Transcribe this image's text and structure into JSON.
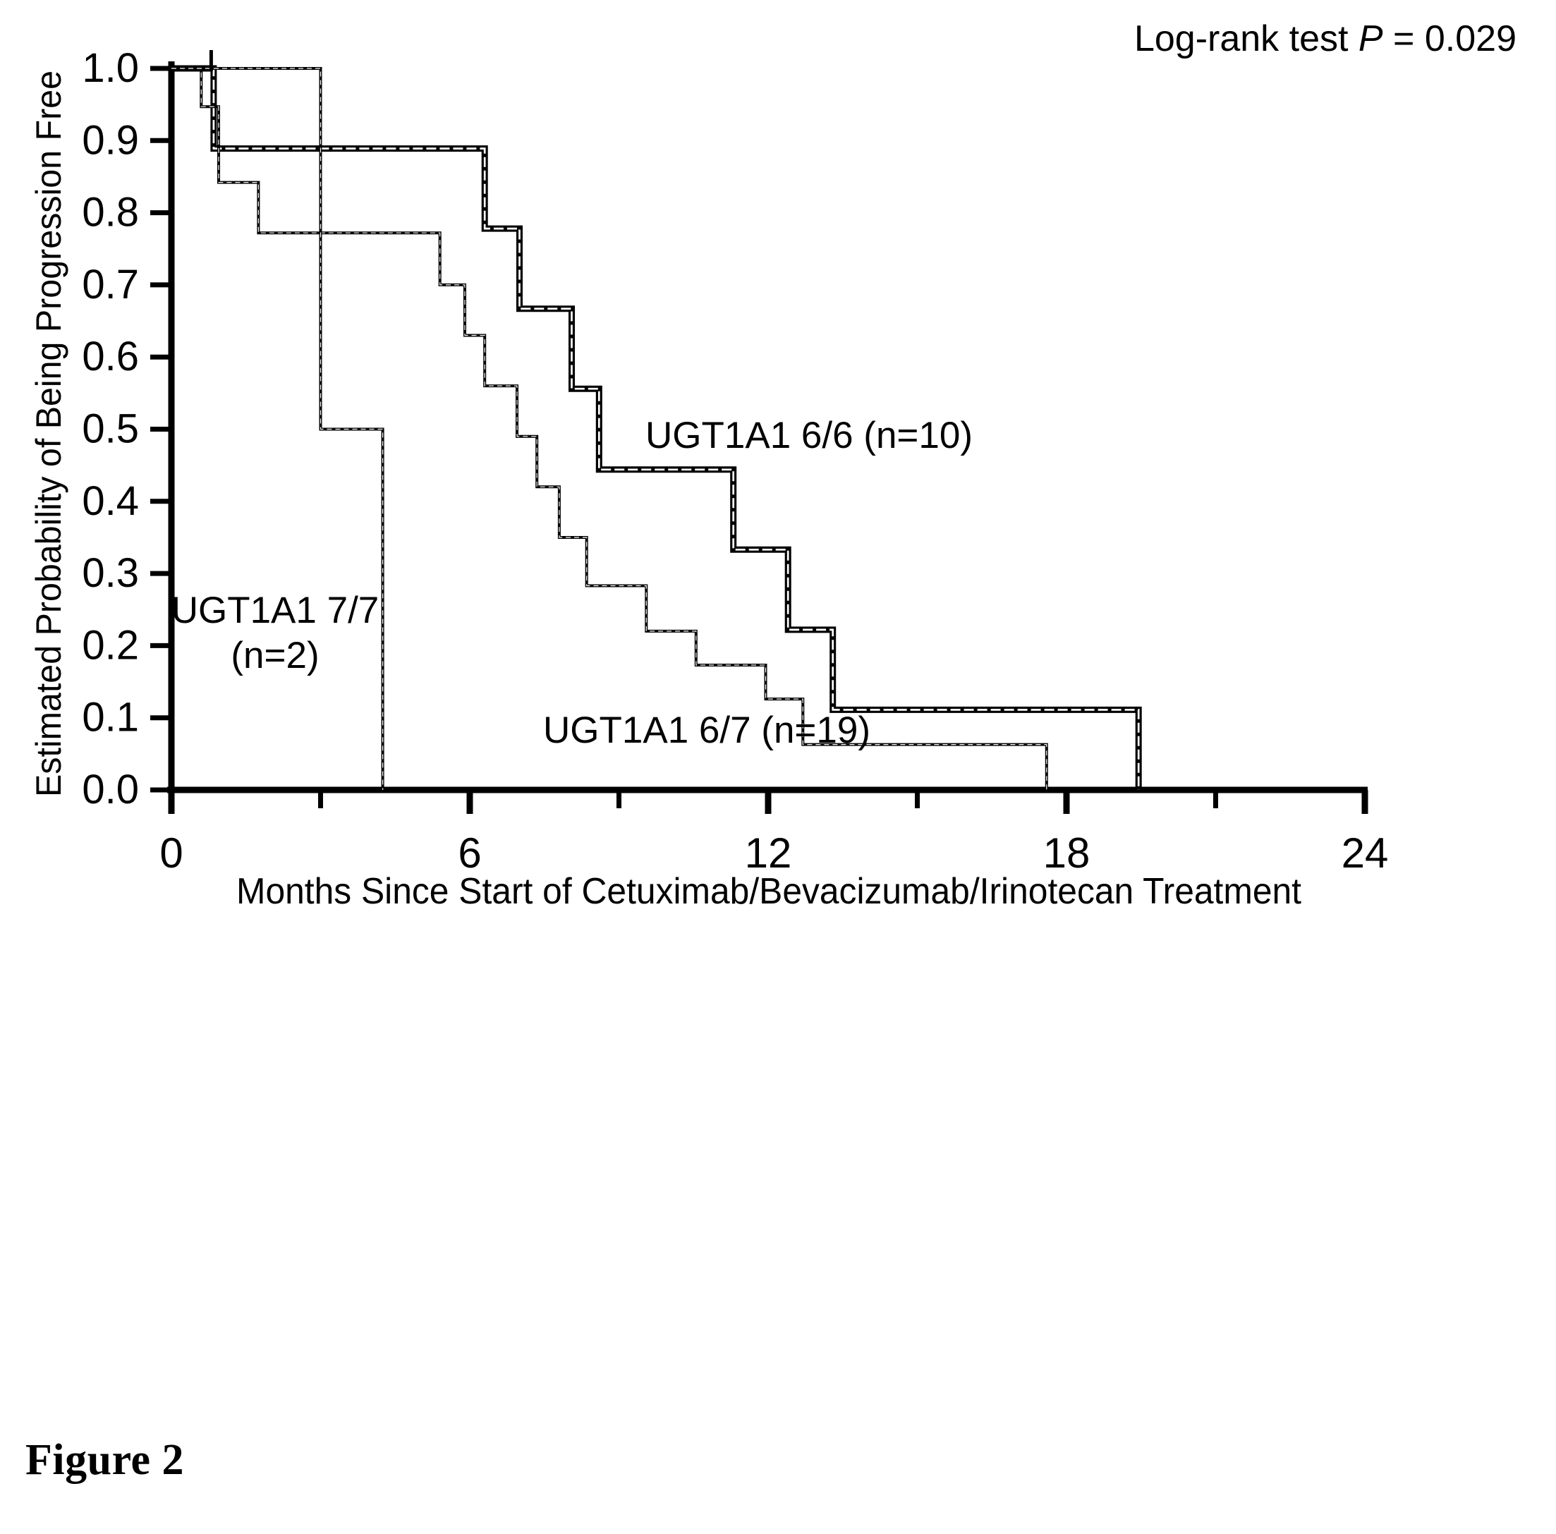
{
  "figure": {
    "caption": "Figure 2",
    "statistic_label": "Log-rank test",
    "statistic_italic": "P",
    "statistic_value": "= 0.029",
    "statistic_full": "Log-rank test P = 0.029"
  },
  "annotations": {
    "curve_66": "UGT1A1 6/6 (n=10)",
    "curve_77_line1": "UGT1A1 7/7",
    "curve_77_line2": "(n=2)",
    "curve_67": "UGT1A1 6/7 (n=19)"
  },
  "colors": {
    "axis": "#000000",
    "curve_66": "#000000",
    "curve_67": "#000000",
    "curve_77": "#000000",
    "background": "#ffffff"
  },
  "chart_data": {
    "type": "line",
    "subtype": "kaplan-meier-step",
    "title": "",
    "xlabel": "Months  Since  Start of Cetuximab/Bevacizumab/Irinotecan Treatment",
    "ylabel": "Estimated Probability  of  Being Progression Free",
    "xlim": [
      0,
      24
    ],
    "ylim": [
      0,
      1
    ],
    "xticks": [
      0,
      6,
      12,
      18,
      24
    ],
    "xtick_labels": [
      "0",
      "6",
      "12",
      "18",
      "24"
    ],
    "xminor_ticks": [
      3,
      9,
      15,
      21
    ],
    "yticks": [
      0.0,
      0.1,
      0.2,
      0.3,
      0.4,
      0.5,
      0.6,
      0.7,
      0.8,
      0.9,
      1.0
    ],
    "ytick_labels": [
      "0.0",
      "0.1",
      "0.2",
      "0.3",
      "0.4",
      "0.5",
      "0.6",
      "0.7",
      "0.8",
      "0.9",
      "1.0"
    ],
    "grid": false,
    "legend_position": "inline-annotations",
    "series": [
      {
        "name": "UGT1A1 6/6 (n=10)",
        "n": 10,
        "style": "thick-solid",
        "linewidth": 9,
        "points": [
          {
            "x": 0.0,
            "y": 1.0
          },
          {
            "x": 0.85,
            "y": 1.0
          },
          {
            "x": 0.85,
            "y": 0.889
          },
          {
            "x": 6.3,
            "y": 0.889
          },
          {
            "x": 6.3,
            "y": 0.778
          },
          {
            "x": 7.0,
            "y": 0.778
          },
          {
            "x": 7.0,
            "y": 0.667
          },
          {
            "x": 8.05,
            "y": 0.667
          },
          {
            "x": 8.05,
            "y": 0.556
          },
          {
            "x": 8.6,
            "y": 0.556
          },
          {
            "x": 8.6,
            "y": 0.444
          },
          {
            "x": 11.3,
            "y": 0.444
          },
          {
            "x": 11.3,
            "y": 0.333
          },
          {
            "x": 12.4,
            "y": 0.333
          },
          {
            "x": 12.4,
            "y": 0.222
          },
          {
            "x": 13.3,
            "y": 0.222
          },
          {
            "x": 13.3,
            "y": 0.111
          },
          {
            "x": 19.45,
            "y": 0.111
          },
          {
            "x": 19.45,
            "y": 0.0
          }
        ],
        "censor_marks": []
      },
      {
        "name": "UGT1A1 6/7 (n=19)",
        "n": 19,
        "style": "thin-dotted",
        "linewidth": 4,
        "points": [
          {
            "x": 0.0,
            "y": 1.0
          },
          {
            "x": 0.6,
            "y": 1.0
          },
          {
            "x": 0.6,
            "y": 0.947
          },
          {
            "x": 0.95,
            "y": 0.947
          },
          {
            "x": 0.95,
            "y": 0.842
          },
          {
            "x": 1.75,
            "y": 0.842
          },
          {
            "x": 1.75,
            "y": 0.772
          },
          {
            "x": 5.4,
            "y": 0.772
          },
          {
            "x": 5.4,
            "y": 0.7
          },
          {
            "x": 5.9,
            "y": 0.7
          },
          {
            "x": 5.9,
            "y": 0.63
          },
          {
            "x": 6.3,
            "y": 0.63
          },
          {
            "x": 6.3,
            "y": 0.56
          },
          {
            "x": 6.95,
            "y": 0.56
          },
          {
            "x": 6.95,
            "y": 0.49
          },
          {
            "x": 7.35,
            "y": 0.49
          },
          {
            "x": 7.35,
            "y": 0.42
          },
          {
            "x": 7.8,
            "y": 0.42
          },
          {
            "x": 7.8,
            "y": 0.35
          },
          {
            "x": 8.35,
            "y": 0.35
          },
          {
            "x": 8.35,
            "y": 0.283
          },
          {
            "x": 9.55,
            "y": 0.283
          },
          {
            "x": 9.55,
            "y": 0.22
          },
          {
            "x": 10.55,
            "y": 0.22
          },
          {
            "x": 10.55,
            "y": 0.173
          },
          {
            "x": 11.95,
            "y": 0.173
          },
          {
            "x": 11.95,
            "y": 0.126
          },
          {
            "x": 12.7,
            "y": 0.126
          },
          {
            "x": 12.7,
            "y": 0.063
          },
          {
            "x": 17.6,
            "y": 0.063
          },
          {
            "x": 17.6,
            "y": 0.0
          }
        ],
        "censor_marks": []
      },
      {
        "name": "UGT1A1 7/7 (n=2)",
        "n": 2,
        "style": "thin-dotted",
        "linewidth": 4,
        "points": [
          {
            "x": 0.0,
            "y": 1.0
          },
          {
            "x": 3.0,
            "y": 1.0
          },
          {
            "x": 3.0,
            "y": 0.5
          },
          {
            "x": 4.25,
            "y": 0.5
          },
          {
            "x": 4.25,
            "y": 0.0
          }
        ],
        "censor_marks": [
          {
            "x": 0.8,
            "y": 1.0
          }
        ]
      }
    ]
  }
}
